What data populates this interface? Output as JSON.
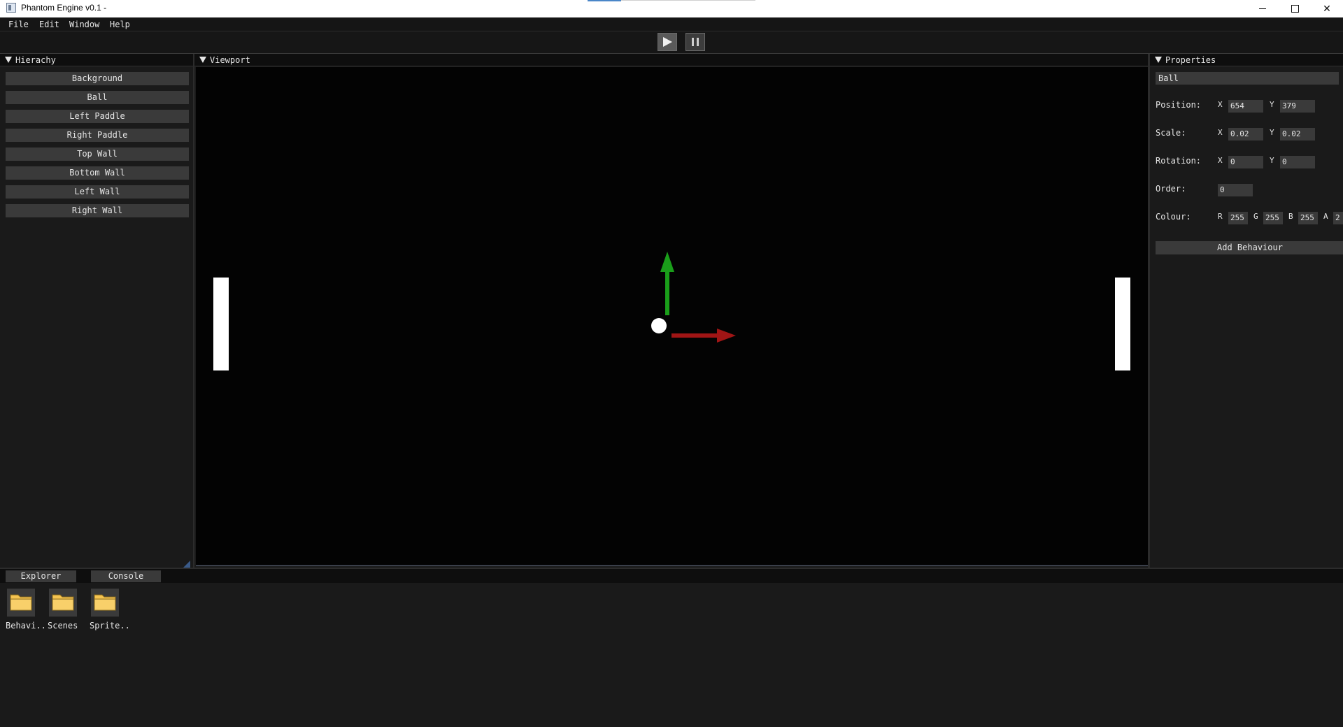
{
  "window": {
    "title": "Phantom Engine v0.1 -",
    "minimize_icon": "minimize-icon",
    "maximize_icon": "maximize-icon",
    "close_label": "✕"
  },
  "menu": {
    "items": [
      "File",
      "Edit",
      "Window",
      "Help"
    ]
  },
  "toolbar": {
    "play_icon": "play-icon",
    "pause_icon": "pause-icon"
  },
  "hierarchy": {
    "title": "Hierachy",
    "items": [
      "Background",
      "Ball",
      "Left Paddle",
      "Right Paddle",
      "Top Wall",
      "Bottom Wall",
      "Left Wall",
      "Right Wall"
    ]
  },
  "viewport": {
    "title": "Viewport",
    "gizmo_colors": {
      "y_axis": "#1a9e1a",
      "x_axis": "#a01515"
    }
  },
  "properties": {
    "title": "Properties",
    "object_name": "Ball",
    "position": {
      "label": "Position:",
      "x_label": "X",
      "y_label": "Y",
      "x": "654",
      "y": "379"
    },
    "scale": {
      "label": "Scale:",
      "x_label": "X",
      "y_label": "Y",
      "x": "0.02",
      "y": "0.02"
    },
    "rotation": {
      "label": "Rotation:",
      "x_label": "X",
      "y_label": "Y",
      "x": "0",
      "y": "0"
    },
    "order": {
      "label": "Order:",
      "value": "0"
    },
    "colour": {
      "label": "Colour:",
      "r_label": "R",
      "g_label": "G",
      "b_label": "B",
      "a_label": "A",
      "r": "255",
      "g": "255",
      "b": "255",
      "a": "2"
    },
    "add_behaviour": "Add Behaviour"
  },
  "bottom": {
    "tabs": [
      "Explorer",
      "Console"
    ],
    "folders": [
      "Behavi..",
      "Scenes",
      "Sprite.."
    ],
    "folder_color": "#f5c451"
  }
}
